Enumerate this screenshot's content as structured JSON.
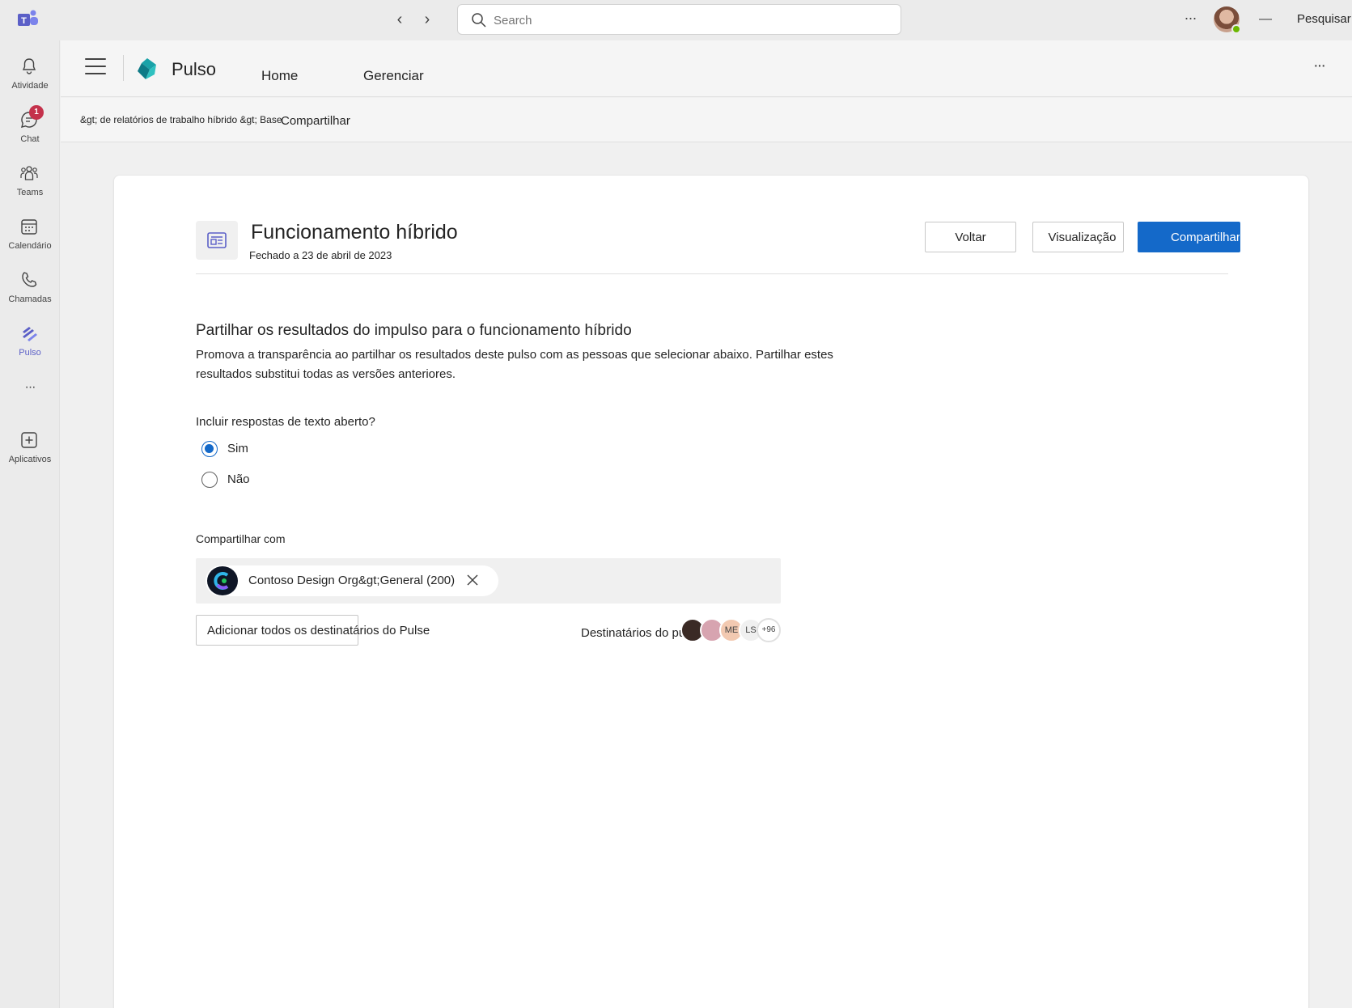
{
  "titlebar": {
    "search_placeholder": "Search",
    "more_label": "···",
    "minimize_label": "—",
    "close_area_text": "Pesquisar"
  },
  "rail": {
    "items": [
      {
        "label": "Atividade",
        "icon": "bell-icon"
      },
      {
        "label": "Chat",
        "icon": "chat-icon",
        "badge": "1"
      },
      {
        "label": "Teams",
        "icon": "teams-icon"
      },
      {
        "label": "Calendário",
        "icon": "calendar-icon"
      },
      {
        "label": "Chamadas",
        "icon": "phone-icon"
      },
      {
        "label": "Pulso",
        "icon": "pulse-icon"
      },
      {
        "label": "···",
        "icon": "more-icon"
      },
      {
        "label": "Aplicativos",
        "icon": "add-apps-icon"
      }
    ]
  },
  "header": {
    "app_name": "Pulso",
    "tabs": [
      {
        "label": "Home"
      },
      {
        "label": "Gerenciar"
      }
    ],
    "more_label": "···"
  },
  "breadcrumb": {
    "path": "&gt; de relatórios de trabalho híbrido &gt; Base",
    "current": "Compartilhar"
  },
  "survey": {
    "title": "Funcionamento híbrido",
    "subtitle": "Fechado a 23 de abril de 2023",
    "buttons": {
      "back": "Voltar",
      "preview": "Visualização",
      "share": "Compartilhar"
    }
  },
  "share_section": {
    "title": "Partilhar os resultados do impulso para o funcionamento híbrido",
    "description": "Promova a transparência ao partilhar os resultados deste pulso com as pessoas que selecionar abaixo. Partilhar estes resultados substitui todas as versões anteriores.",
    "question": "Incluir respostas de texto aberto?",
    "options": [
      {
        "label": "Sim",
        "checked": true
      },
      {
        "label": "Não",
        "checked": false
      }
    ],
    "share_with_label": "Compartilhar com",
    "chip_label": "Contoso Design Org&gt;General (200)",
    "add_all_label": "Adicionar todos os destinatários do Pulse",
    "recipients_label": "Destinatários do pulso",
    "avatars": [
      {
        "initials": "",
        "color": "#3a2a25"
      },
      {
        "initials": "",
        "color": "#d7a4b0"
      },
      {
        "initials": "ME",
        "color": "#f2c9b1"
      },
      {
        "initials": "LS",
        "color": "#f0f0f0"
      },
      {
        "initials": "+96",
        "color": "#ffffff"
      }
    ]
  },
  "colors": {
    "accent": "#1469c9",
    "brand": "#5b5fc7",
    "badge": "#c4314b"
  }
}
